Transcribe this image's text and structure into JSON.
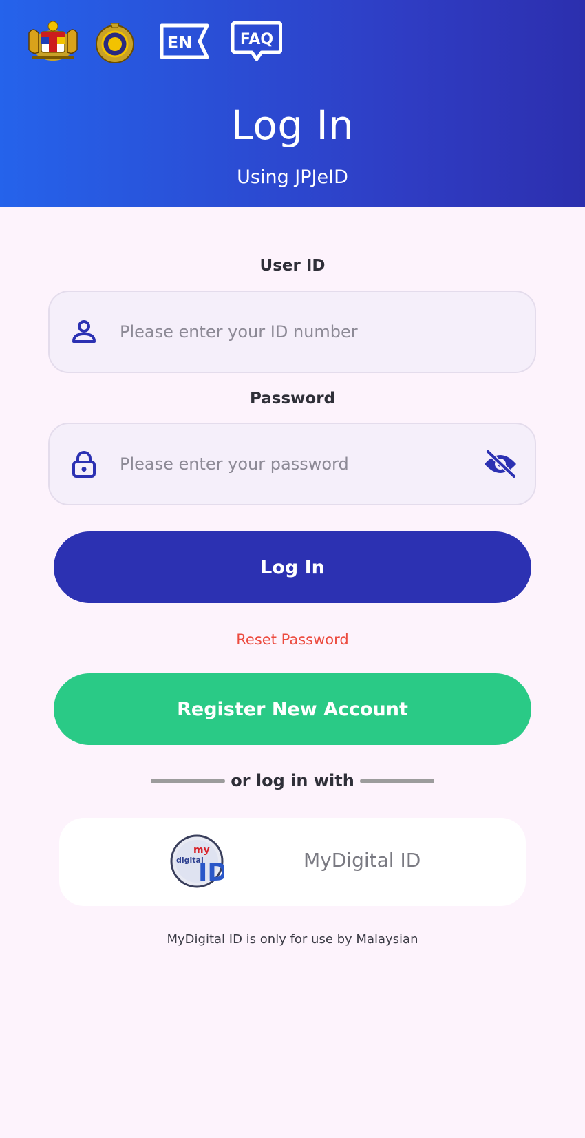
{
  "header": {
    "lang_label": "EN",
    "faq_label": "FAQ",
    "title": "Log In",
    "subtitle": "Using JPJeID",
    "icons": [
      "malaysia-coat-of-arms-icon",
      "jpj-logo-icon",
      "language-toggle-icon",
      "faq-icon"
    ]
  },
  "form": {
    "user_id": {
      "label": "User ID",
      "placeholder": "Please enter your ID number",
      "value": "",
      "icon": "user-icon"
    },
    "password": {
      "label": "Password",
      "placeholder": "Please enter your password",
      "value": "",
      "icon": "lock-icon",
      "toggle_icon": "eye-off-icon"
    },
    "login_button": "Log In",
    "reset_link": "Reset Password",
    "register_button": "Register New Account"
  },
  "alt_login": {
    "divider_text": "or log in with",
    "mydigital_label": "MyDigital ID",
    "logo_text_my": "my",
    "logo_text_digital": "digital",
    "logo_text_id": "ID",
    "footnote": "MyDigital ID is only for use by Malaysian"
  },
  "colors": {
    "header_gradient_start": "#2563eb",
    "header_gradient_end": "#2c2fae",
    "background": "#fdf3fc",
    "primary_button": "#2c31b2",
    "register_button": "#2aca86",
    "reset_link": "#ec4b3f",
    "icon_accent": "#2c31b2"
  }
}
